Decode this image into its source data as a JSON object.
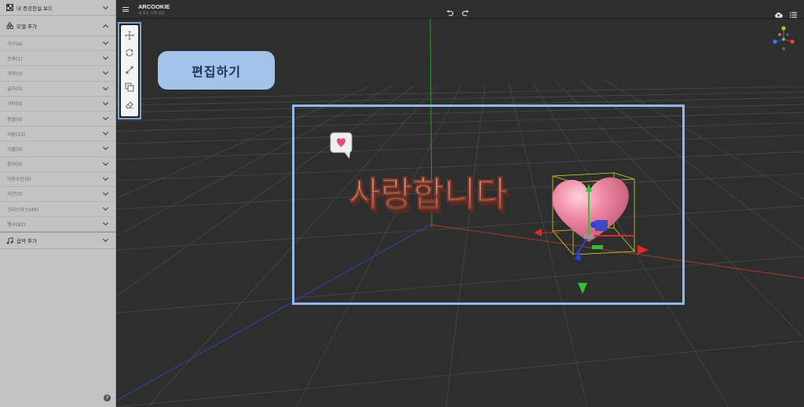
{
  "app": {
    "title": "ARCOOKIE",
    "subtitle": "내 좌상 오제 날림"
  },
  "sidebar": {
    "board_section": "내 증강현실 보드",
    "model_section": "모델 추가",
    "items": [
      {
        "label": "가구(4)"
      },
      {
        "label": "건축(1)"
      },
      {
        "label": "과학(0)"
      },
      {
        "label": "글자(0)"
      },
      {
        "label": "기타(0)"
      },
      {
        "label": "동물(0)"
      },
      {
        "label": "사람(13)"
      },
      {
        "label": "식물(0)"
      },
      {
        "label": "음식(0)"
      },
      {
        "label": "이동수단(0)"
      },
      {
        "label": "자연(0)"
      },
      {
        "label": "크리스마스(49)"
      },
      {
        "label": "행사(82)"
      }
    ],
    "music_section": "음악 추가",
    "help": "?"
  },
  "viewport": {
    "edit_label": "편집하기",
    "scene_text": "사랑합니다"
  },
  "icons": {
    "menu": "hamburger-icon",
    "undo": "undo-icon",
    "redo": "redo-icon",
    "upload": "cloud-upload-icon",
    "settings": "sliders-icon",
    "move": "move-icon",
    "rotate": "rotate-icon",
    "scale": "scale-icon",
    "duplicate": "duplicate-icon",
    "erase": "eraser-icon"
  },
  "colors": {
    "accent": "#93b7e8",
    "pill": "#a3c3ea",
    "sidebar": "#c3c3c3",
    "canvas": "#2e2e2e"
  }
}
